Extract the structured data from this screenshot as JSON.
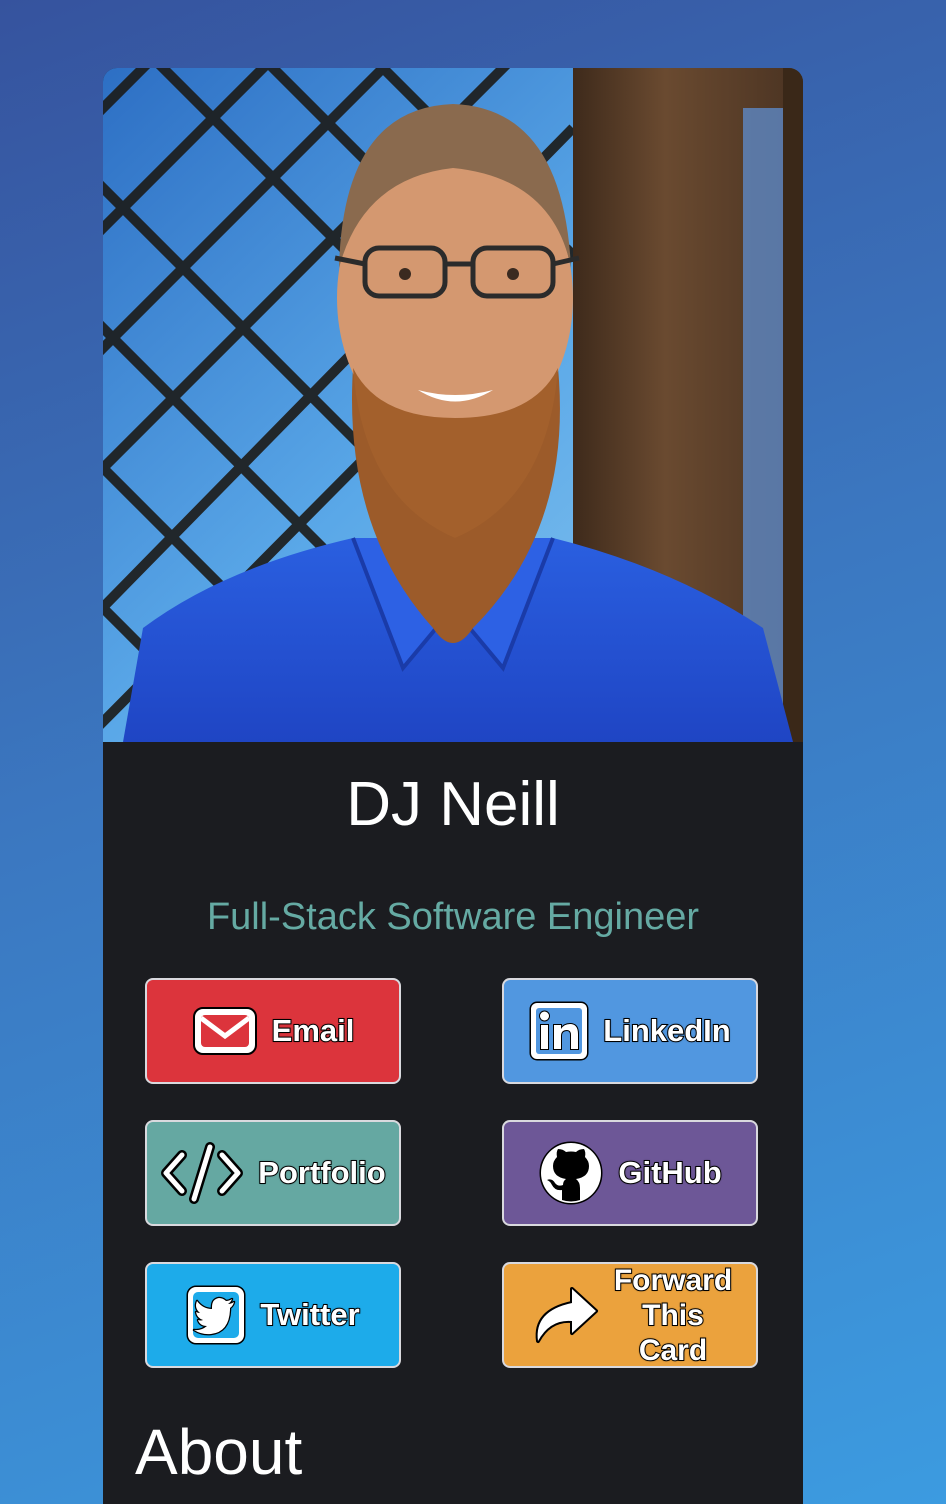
{
  "profile": {
    "name": "DJ Neill",
    "title": "Full-Stack Software Engineer"
  },
  "buttons": {
    "email": {
      "label": "Email",
      "icon": "envelope-icon",
      "color": "#dc343c"
    },
    "linkedin": {
      "label": "LinkedIn",
      "icon": "linkedin-icon",
      "color": "#5197e0"
    },
    "portfolio": {
      "label": "Portfolio",
      "icon": "code-icon",
      "color": "#65a8a2"
    },
    "github": {
      "label": "GitHub",
      "icon": "github-icon",
      "color": "#6d5797"
    },
    "twitter": {
      "label": "Twitter",
      "icon": "twitter-icon",
      "color": "#1dabea"
    },
    "forward": {
      "label_lines": [
        "Forward",
        "This",
        "Card"
      ],
      "icon": "share-arrow-icon",
      "color": "#eba23d"
    }
  },
  "sections": {
    "about_heading": "About"
  },
  "colors": {
    "card_background": "#1b1c20",
    "title_accent": "#65aaa3"
  }
}
